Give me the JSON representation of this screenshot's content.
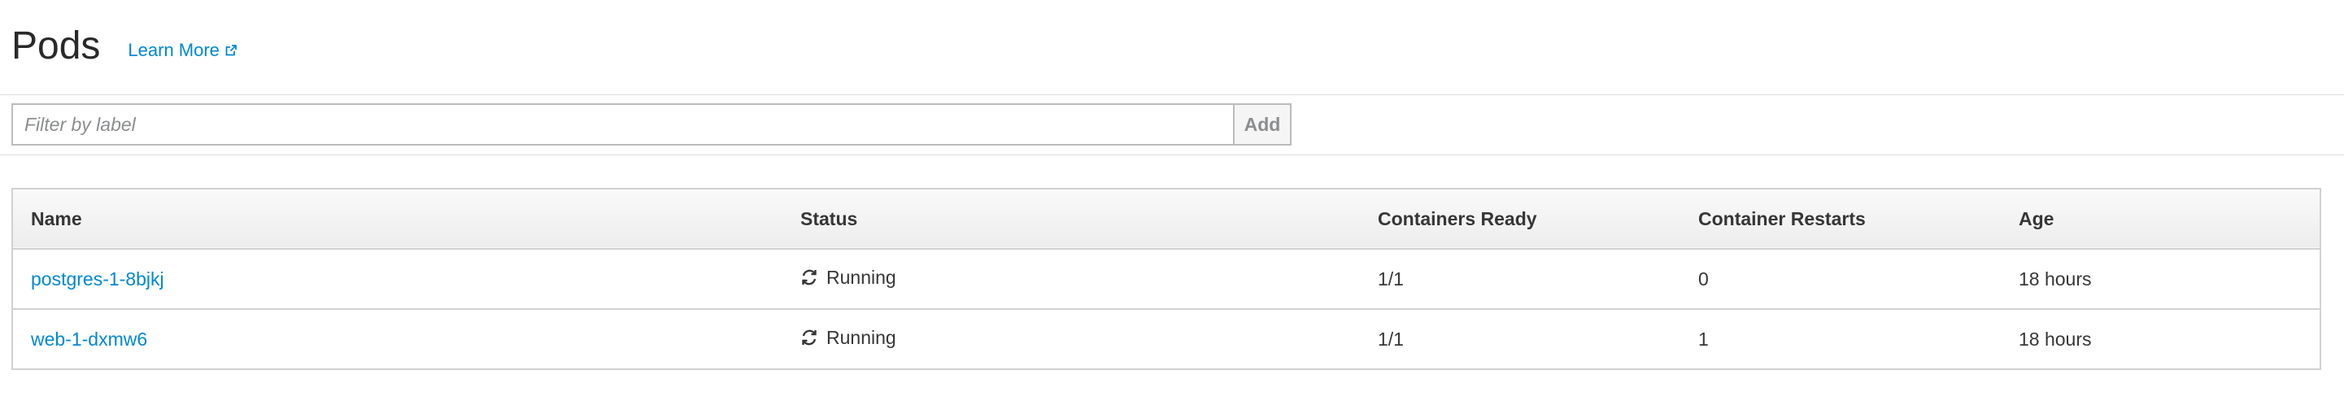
{
  "page": {
    "title": "Pods",
    "learn_more": "Learn More",
    "accent_color": "#0088ce"
  },
  "filter": {
    "placeholder": "Filter by label",
    "value": "",
    "add_label": "Add"
  },
  "table": {
    "columns": [
      "Name",
      "Status",
      "Containers Ready",
      "Container Restarts",
      "Age"
    ],
    "rows": [
      {
        "name": "postgres-1-8bjkj",
        "status": "Running",
        "status_icon": "refresh-icon",
        "containers_ready": "1/1",
        "restarts": "0",
        "age": "18 hours"
      },
      {
        "name": "web-1-dxmw6",
        "status": "Running",
        "status_icon": "refresh-icon",
        "containers_ready": "1/1",
        "restarts": "1",
        "age": "18 hours"
      }
    ]
  }
}
